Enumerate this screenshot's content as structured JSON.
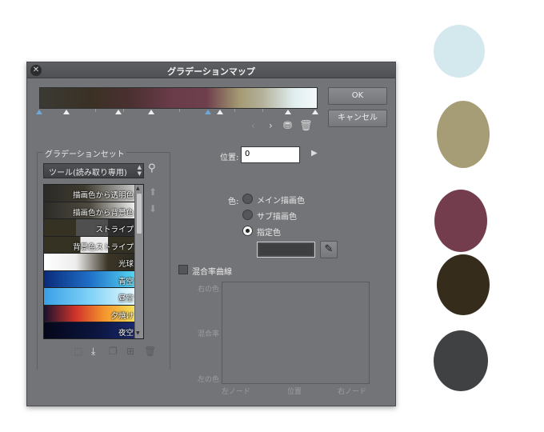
{
  "window": {
    "title": "グラデーションマップ",
    "ok_label": "OK",
    "cancel_label": "キャンセル"
  },
  "gradient_set": {
    "group_label": "グラデーションセット",
    "selected": "ツール(読み取り専用)",
    "presets": [
      {
        "name": "描画色から透明色"
      },
      {
        "name": "描画色から背景色"
      },
      {
        "name": "ストライプ"
      },
      {
        "name": "背景色ストライプ"
      },
      {
        "name": "光球"
      },
      {
        "name": "青空"
      },
      {
        "name": "昼空"
      },
      {
        "name": "夕焼け"
      },
      {
        "name": "夜空"
      }
    ]
  },
  "position": {
    "label": "位置:",
    "value": "0"
  },
  "color": {
    "label": "色:",
    "options": [
      "メイン描画色",
      "サブ描画色",
      "指定色"
    ],
    "selected_index": 2,
    "swatch_color": "#3e3f41"
  },
  "blend": {
    "checkbox_label": "混合率曲線",
    "checked": false,
    "y_top": "右の色",
    "y_mid": "混合率",
    "y_bottom": "左の色",
    "x_left": "左ノード",
    "x_mid": "位置",
    "x_right": "右ノード"
  },
  "palette": {
    "colors": [
      "#d4e9ee",
      "#a69c76",
      "#733d4d",
      "#362c1b",
      "#3f4143"
    ]
  }
}
